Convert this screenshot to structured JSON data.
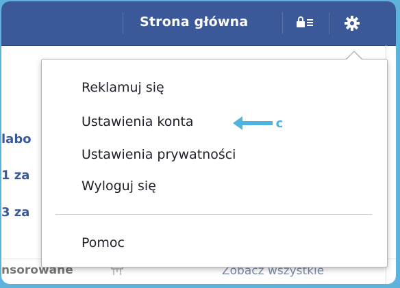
{
  "topbar": {
    "home_label": "Strona główna"
  },
  "left_fragments": [
    "labo",
    "1 za",
    "3 za"
  ],
  "footer": {
    "sponsored": "nsorowane",
    "see_all": "Zobacz wszystkie"
  },
  "menu": {
    "items": [
      "Reklamuj się",
      "Ustawienia konta",
      "Ustawienia prywatności",
      "Wyloguj się"
    ],
    "help": "Pomoc"
  },
  "annotation": {
    "label": "c",
    "color": "#4fb3e0"
  },
  "colors": {
    "topbar": "#3b5998",
    "link": "#3b5998",
    "frame": "#5db3dc"
  }
}
